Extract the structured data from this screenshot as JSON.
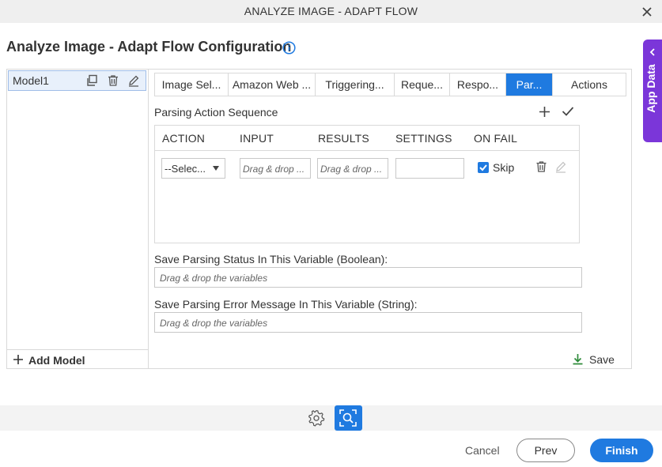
{
  "window": {
    "title": "ANALYZE IMAGE - ADAPT FLOW"
  },
  "page": {
    "heading": "Analyze Image - Adapt Flow Configuration"
  },
  "side_panel": {
    "label": "App Data"
  },
  "models": {
    "items": [
      {
        "label": "Model1"
      }
    ],
    "add_label": "Add Model"
  },
  "tabs": [
    {
      "label": "Image Sel..."
    },
    {
      "label": "Amazon Web ..."
    },
    {
      "label": "Triggering..."
    },
    {
      "label": "Reque..."
    },
    {
      "label": "Respo..."
    },
    {
      "label": "Par...",
      "active": true
    },
    {
      "label": "Actions"
    }
  ],
  "parsing": {
    "title": "Parsing Action Sequence",
    "columns": [
      "ACTION",
      "INPUT",
      "RESULTS",
      "SETTINGS",
      "ON FAIL"
    ],
    "row": {
      "action_value": "--Selec...",
      "input_placeholder": "Drag & drop ...",
      "results_placeholder": "Drag & drop ...",
      "settings_value": "",
      "on_fail_checked": true,
      "on_fail_label": "Skip"
    }
  },
  "fields": {
    "status_label": "Save Parsing Status In This Variable (Boolean):",
    "status_placeholder": "Drag & drop the variables",
    "error_label": "Save Parsing Error Message In This Variable (String):",
    "error_placeholder": "Drag & drop the variables"
  },
  "save_label": "Save",
  "footer": {
    "cancel": "Cancel",
    "prev": "Prev",
    "finish": "Finish"
  },
  "colors": {
    "accent": "#1f7ae0",
    "side_panel": "#7b36d9",
    "save_icon": "#2e8b3a"
  }
}
